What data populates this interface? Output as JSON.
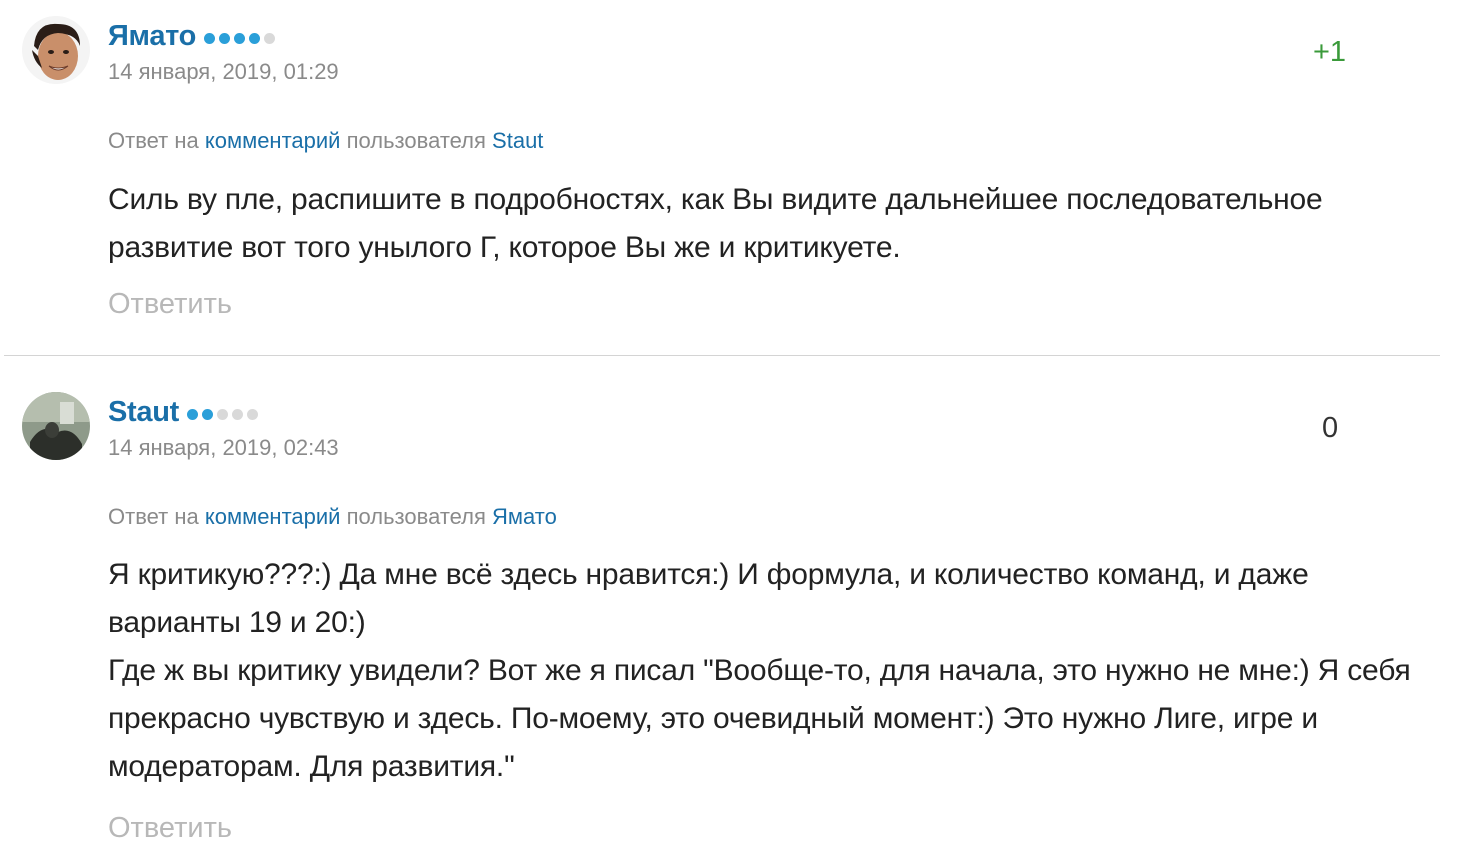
{
  "comments": [
    {
      "author": "Ямато",
      "rating_dots": [
        1,
        1,
        1,
        1,
        0
      ],
      "date": "14 января, 2019, 01:29",
      "score": "+1",
      "score_color": "#3a9a3a",
      "reply_prefix": "Ответ на",
      "reply_link": "комментарий",
      "reply_mid": "пользователя",
      "reply_user": "Staut",
      "text": [
        "Силь ву пле, распишите в подробностях, как Вы видите дальнейшее последовательное развитие вот того унылого Г, которое Вы же и критикуете."
      ],
      "reply_button": "Ответить"
    },
    {
      "author": "Staut",
      "rating_dots": [
        1,
        1,
        0,
        0,
        0
      ],
      "date": "14 января, 2019, 02:43",
      "score": "0",
      "score_color": "#333333",
      "reply_prefix": "Ответ на",
      "reply_link": "комментарий",
      "reply_mid": "пользователя",
      "reply_user": "Ямато",
      "text": [
        "Я критикую???:) Да мне всё здесь нравится:) И формула, и количество команд, и даже варианты 19 и 20:)",
        "Где ж вы критику увидели? Вот же я писал \"Вообще-то, для начала, это нужно не мне:) Я себя прекрасно чувствую и здесь. По-моему, это очевидный момент:) Это нужно Лиге, игре и модераторам. Для развития.\""
      ],
      "reply_button": "Ответить"
    }
  ],
  "colors": {
    "link": "#1a6fa8",
    "dot_active": "#2a9fd9",
    "dot_inactive": "#d9d9d9",
    "muted": "#8a8a8a",
    "reply_button": "#b8b8b8"
  }
}
